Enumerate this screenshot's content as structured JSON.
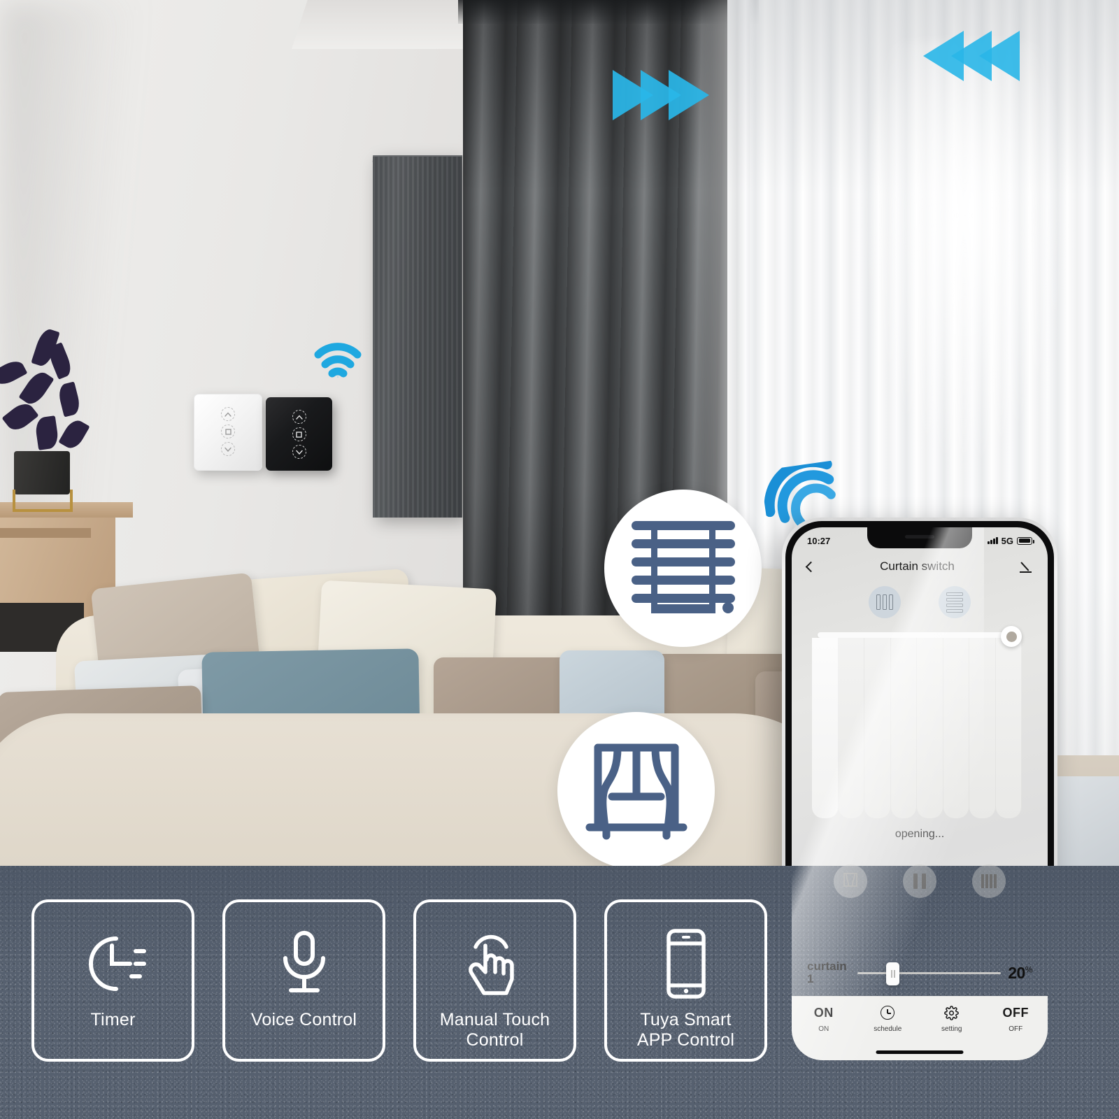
{
  "scene": {
    "alt": "Living room with sofa, dark curtain and sheer white curtain, smart curtain wall switches on wall",
    "wifi_icon_wall": "wifi-icon",
    "wifi_icon_phone": "wifi-icon",
    "arrows_right": "curtain-closing-arrows",
    "arrows_left": "curtain-opening-arrows"
  },
  "wall_switches": [
    {
      "name": "white-curtain-switch",
      "finish": "white",
      "buttons": [
        "up",
        "stop",
        "down"
      ]
    },
    {
      "name": "black-curtain-switch",
      "finish": "black",
      "buttons": [
        "up",
        "stop",
        "down"
      ]
    }
  ],
  "badges": [
    {
      "name": "blinds-badge",
      "icon": "venetian-blinds-icon",
      "color": "#4a6186"
    },
    {
      "name": "curtain-badge",
      "icon": "window-curtain-icon",
      "color": "#4a6186"
    }
  ],
  "phone": {
    "status_bar": {
      "time": "10:27",
      "network": "5G",
      "signal_icon": "signal-bars-icon",
      "battery_icon": "battery-icon"
    },
    "app_bar": {
      "back_icon": "chevron-left-icon",
      "title": "Curtain switch",
      "edit_icon": "pencil-icon"
    },
    "mode_buttons": [
      {
        "name": "vertical-blinds-mode",
        "icon": "vertical-blinds-icon"
      },
      {
        "name": "horizontal-blinds-mode",
        "icon": "horizontal-blinds-icon"
      }
    ],
    "curtain_view": {
      "position_percent": 20,
      "knob_icon": "slider-knob"
    },
    "status_text": "opening...",
    "controls": [
      {
        "name": "open-button",
        "icon": "curtain-open-icon"
      },
      {
        "name": "pause-button",
        "icon": "pause-icon"
      },
      {
        "name": "close-button",
        "icon": "curtain-close-icon"
      }
    ],
    "slider": {
      "label": "curtain1",
      "value_percent": 20,
      "value_text": "20",
      "unit": "%",
      "fill_percent": 20
    },
    "tabs": [
      {
        "name": "tab-on",
        "glyph": "ON",
        "glyph_type": "text",
        "label": "ON"
      },
      {
        "name": "tab-schedule",
        "glyph": "clock-icon",
        "glyph_type": "icon",
        "label": "schedule"
      },
      {
        "name": "tab-setting",
        "glyph": "gear-icon",
        "glyph_type": "icon",
        "label": "setting"
      },
      {
        "name": "tab-off",
        "glyph": "OFF",
        "glyph_type": "text",
        "label": "OFF"
      }
    ]
  },
  "features": [
    {
      "name": "feature-timer",
      "icon": "timer-icon",
      "label": "Timer"
    },
    {
      "name": "feature-voice",
      "icon": "microphone-icon",
      "label": "Voice Control"
    },
    {
      "name": "feature-manual-touch",
      "icon": "touch-hand-icon",
      "label": "Manual Touch\nControl"
    },
    {
      "name": "feature-tuya-app",
      "icon": "smartphone-icon",
      "label": "Tuya Smart\nAPP Control"
    }
  ],
  "colors": {
    "accent_blue": "#29b6e8",
    "badge_blue": "#4a6186",
    "panel_bg": "#56606f",
    "card_border": "#ffffff"
  }
}
